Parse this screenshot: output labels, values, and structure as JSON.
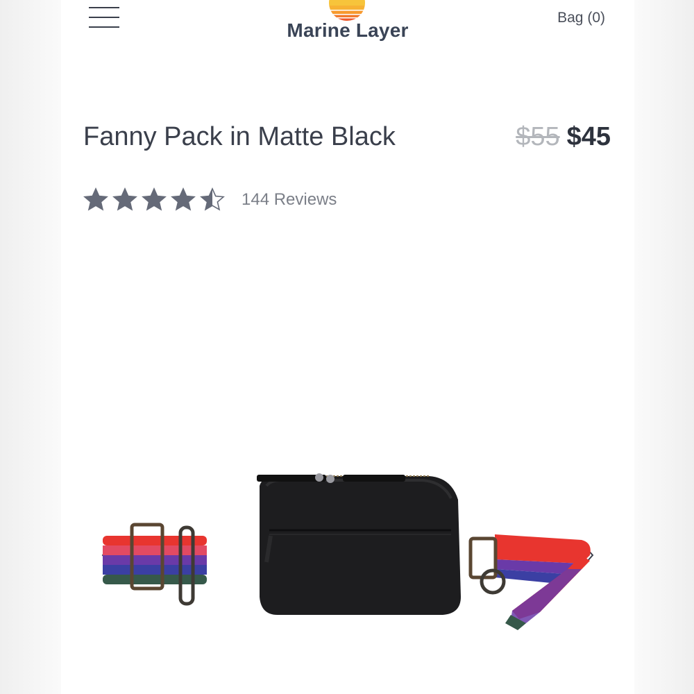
{
  "header": {
    "menu_icon": "hamburger-menu-icon",
    "brand": "Marine Layer",
    "bag_label": "Bag (0)",
    "logo_colors": [
      "#f7c43b",
      "#f79a2e",
      "#ee5a2c"
    ]
  },
  "product": {
    "title": "Fanny Pack in Matte Black",
    "price_original": "$55",
    "price_sale": "$45",
    "rating": 4.5,
    "rating_max": 5,
    "reviews": "144 Reviews"
  },
  "gallery": {
    "prev_icon": "chevron-left-icon",
    "next_icon": "chevron-right-icon",
    "strap_colors": [
      "#e8352f",
      "#e24a63",
      "#6a3aa8",
      "#3b3fa3",
      "#36594a"
    ],
    "bag_color": "#1d1d1f"
  },
  "colors": {
    "text": "#3a3f4b",
    "muted": "#7b7f88",
    "star": "#656a78"
  }
}
